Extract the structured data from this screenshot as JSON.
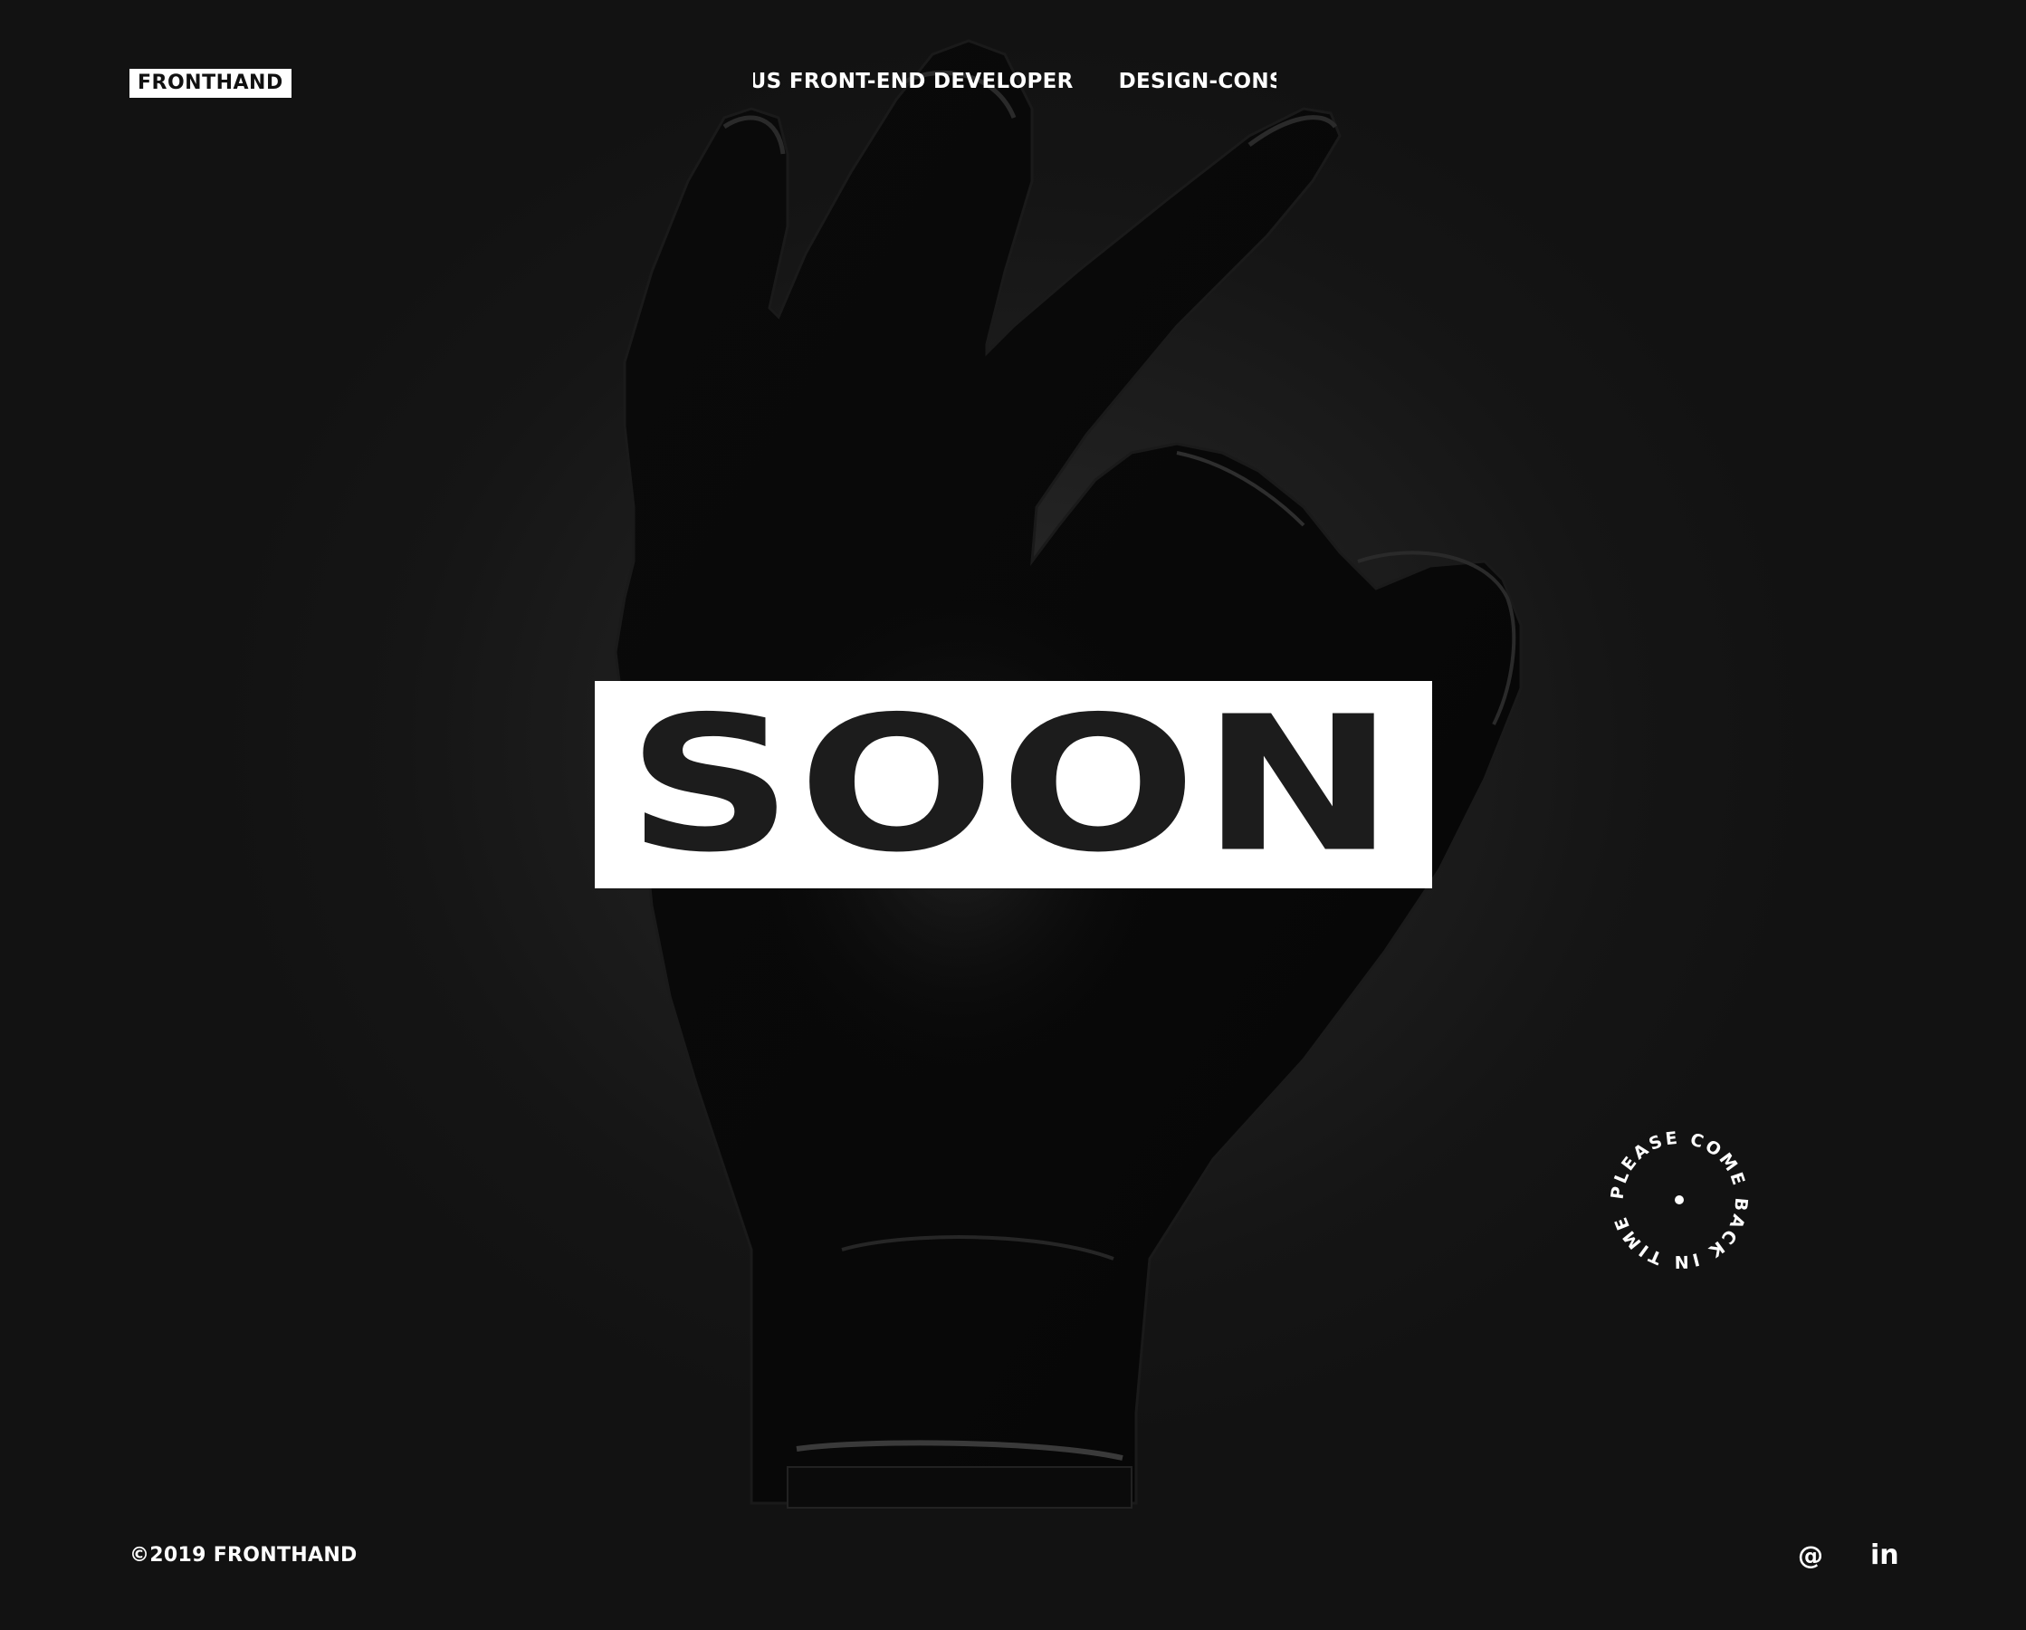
{
  "brand": {
    "logo_text": "FRONTHAND"
  },
  "header": {
    "marquee_items": [
      "AMBITIOUS FRONT-END DEVELOPER",
      "DESIGN-CONSCIOUS"
    ]
  },
  "hero": {
    "headline": "SOON"
  },
  "badge": {
    "circular_text": "PLEASE COME BACK IN TIME"
  },
  "footer": {
    "copyright": "©2019 FRONTHAND",
    "email_label": "@",
    "linkedin_label": "in"
  },
  "colors": {
    "background": "#151515",
    "text": "#ffffff",
    "headline_box": "#ffffff",
    "headline_text": "#1c1c1c"
  }
}
